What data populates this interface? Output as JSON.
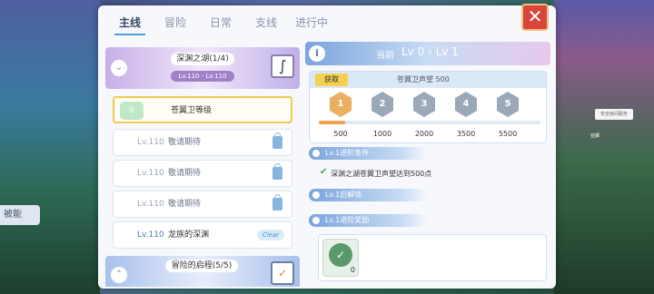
{
  "background": {
    "left_chip_label": "被能",
    "npc_label": "安全房间服务",
    "npc_name": "亚娜"
  },
  "tabs": [
    "主线",
    "冒险",
    "日常",
    "支线",
    "进行中"
  ],
  "active_tab": "主线",
  "close_label": "✕",
  "chapters": [
    {
      "title": "深渊之湖(1/4)",
      "level_range": "Lv.110 - Lv.110",
      "expand_icon": "chevron-down-icon",
      "icon": "feather-icon"
    },
    {
      "title": "冒险的启程(5/5)",
      "expand_icon": "chevron-up-icon",
      "icon": "checklist-icon"
    }
  ],
  "quests": [
    {
      "badge": "0",
      "name": "苍翼卫等级",
      "selected": true
    },
    {
      "level": "Lv.110",
      "name": "敬请期待",
      "locked": true
    },
    {
      "level": "Lv.110",
      "name": "敬请期待",
      "locked": true
    },
    {
      "level": "Lv.110",
      "name": "敬请期待",
      "locked": true
    },
    {
      "level": "Lv.110",
      "name": "龙族的深渊",
      "clear": "Clear"
    }
  ],
  "detail": {
    "current_label": "当前",
    "level_from": "Lv 0",
    "level_to": "Lv 1",
    "get_label": "获取",
    "progress_title": "苍翼卫声望 500",
    "progress_fraction": 0.12,
    "medals": [
      "1",
      "2",
      "3",
      "4",
      "5"
    ],
    "thresholds": [
      "500",
      "1000",
      "2000",
      "3500",
      "5500"
    ],
    "section_condition": "Lv.1进阶条件",
    "condition_text": "深渊之湖苍翼卫声望达到500点",
    "section_unlock": "Lv.1后解锁",
    "section_reward": "Lv.1进阶奖励",
    "reward_qty": "0"
  },
  "colors": {
    "accent": "#4aa0e0",
    "close": "#d8463a",
    "progress": "#f0a050",
    "selected_border": "#f0c850"
  }
}
